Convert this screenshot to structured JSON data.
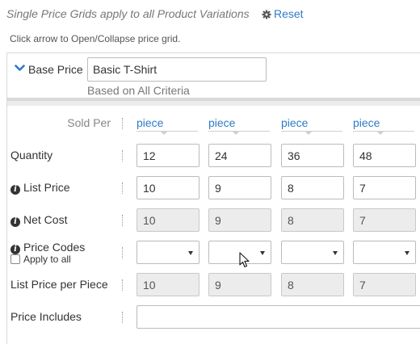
{
  "header": {
    "notice": "Single Price Grids apply to all Product Variations",
    "reset_label": "Reset",
    "reset_icon": "gear-icon",
    "hint": "Click arrow to Open/Collapse price grid."
  },
  "panel": {
    "toggle_icon": "chevron-down-icon",
    "base_price_label": "Base Price",
    "name_value": "Basic T-Shirt",
    "based_on": "Based on All Criteria"
  },
  "grid": {
    "sold_per_label": "Sold Per",
    "units": [
      "piece",
      "piece",
      "piece",
      "piece"
    ],
    "quantity_label": "Quantity",
    "quantities": [
      "12",
      "24",
      "36",
      "48"
    ],
    "list_price_label": "List Price",
    "list_prices": [
      "10",
      "9",
      "8",
      "7"
    ],
    "net_cost_label": "Net Cost",
    "net_costs": [
      "10",
      "9",
      "8",
      "7"
    ],
    "price_codes_label": "Price Codes",
    "apply_to_all_label": "Apply to all",
    "price_codes": [
      "",
      "",
      "",
      ""
    ],
    "list_price_per_piece_label": "List Price per Piece",
    "list_price_per_piece": [
      "10",
      "9",
      "8",
      "7"
    ],
    "price_includes_label": "Price Includes",
    "price_includes_value": ""
  },
  "colors": {
    "link": "#2f7ac9",
    "readonly_bg": "#ececec",
    "band": "#d9d9d9"
  }
}
